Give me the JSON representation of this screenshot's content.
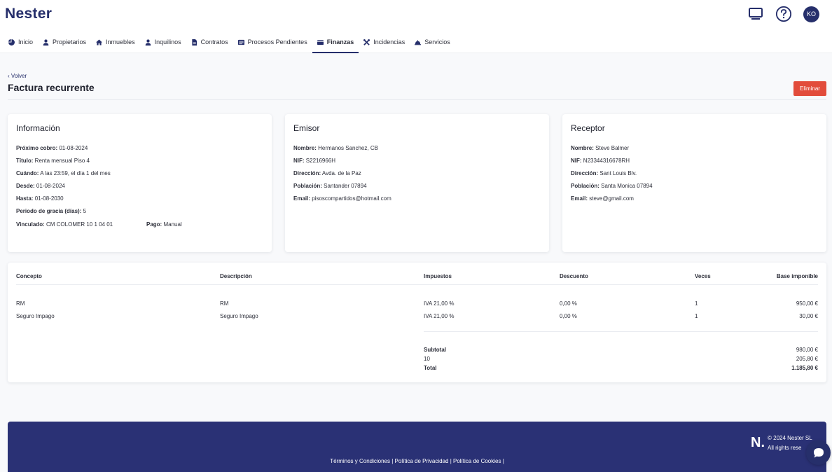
{
  "app": {
    "logo": "Nester",
    "avatar_initials": "KO"
  },
  "nav": [
    {
      "label": "Inicio",
      "icon": "pie-chart-icon"
    },
    {
      "label": "Propietarios",
      "icon": "user-icon"
    },
    {
      "label": "Inmuebles",
      "icon": "home-icon"
    },
    {
      "label": "Inquilinos",
      "icon": "user-icon"
    },
    {
      "label": "Contratos",
      "icon": "document-icon"
    },
    {
      "label": "Procesos Pendientes",
      "icon": "list-icon"
    },
    {
      "label": "Finanzas",
      "icon": "wallet-icon",
      "active": true
    },
    {
      "label": "Incidencias",
      "icon": "tools-icon"
    },
    {
      "label": "Servicios",
      "icon": "service-bell-icon"
    }
  ],
  "page": {
    "back_label": "Volver",
    "title": "Factura recurrente",
    "delete_label": "Eliminar"
  },
  "info": {
    "title": "Información",
    "fields": [
      {
        "label": "Próximo cobro:",
        "value": "01-08-2024"
      },
      {
        "label": "Título:",
        "value": "Renta mensual Piso 4"
      },
      {
        "label": "Cuándo:",
        "value": "A las 23:59, el día 1 del mes"
      },
      {
        "label": "Desde:",
        "value": "01-08-2024"
      },
      {
        "label": "Hasta:",
        "value": "01-08-2030"
      },
      {
        "label": "Periodo de gracia (días):",
        "value": "5"
      },
      {
        "label": "Vinculado:",
        "value": "CM COLOMER 10 1 04 01"
      }
    ],
    "payment": {
      "label": "Pago:",
      "value": "Manual"
    }
  },
  "emisor": {
    "title": "Emisor",
    "fields": [
      {
        "label": "Nombre:",
        "value": "Hermanos Sanchez, CB"
      },
      {
        "label": "NIF:",
        "value": "S2216966H"
      },
      {
        "label": "Dirección:",
        "value": "Avda. de la Paz"
      },
      {
        "label": "Población:",
        "value": "Santander 07894"
      },
      {
        "label": "Email:",
        "value": "pisoscompartidos@hotmail.com"
      }
    ]
  },
  "receptor": {
    "title": "Receptor",
    "fields": [
      {
        "label": "Nombre:",
        "value": "Steve Balmer"
      },
      {
        "label": "NIF:",
        "value": "N23344316678RH"
      },
      {
        "label": "Dirección:",
        "value": "Sant Louis Blv."
      },
      {
        "label": "Población:",
        "value": "Santa Monica 07894"
      },
      {
        "label": "Email:",
        "value": "steve@gmail.com"
      }
    ]
  },
  "lines": {
    "headers": {
      "concepto": "Concepto",
      "descripcion": "Descripción",
      "impuestos": "Impuestos",
      "descuento": "Descuento",
      "veces": "Veces",
      "base": "Base imponible"
    },
    "rows": [
      {
        "concepto": "RM",
        "descripcion": "RM",
        "impuestos": "IVA 21,00 %",
        "descuento": "0,00 %",
        "veces": "1",
        "base": "950,00 €"
      },
      {
        "concepto": "Seguro Impago",
        "descripcion": "Seguro Impago",
        "impuestos": "IVA 21,00 %",
        "descuento": "0,00 %",
        "veces": "1",
        "base": "30,00 €"
      }
    ],
    "totals": [
      {
        "label": "Subtotal",
        "value": "980,00 €",
        "bold": true
      },
      {
        "label": "10",
        "value": "205,80 €",
        "bold": false
      },
      {
        "label": "Total",
        "value": "1.185,80 €",
        "bold": true
      }
    ]
  },
  "footer": {
    "logo": "N.",
    "copyright": "© 2024 Nester SL",
    "rights": "All rights rese",
    "links": [
      "Términos y Condiciones",
      "Política de Privacidad",
      "Política de Cookies"
    ]
  },
  "colors": {
    "brand": "#262f6b",
    "danger": "#e24c3b",
    "footer": "#2a3175"
  }
}
